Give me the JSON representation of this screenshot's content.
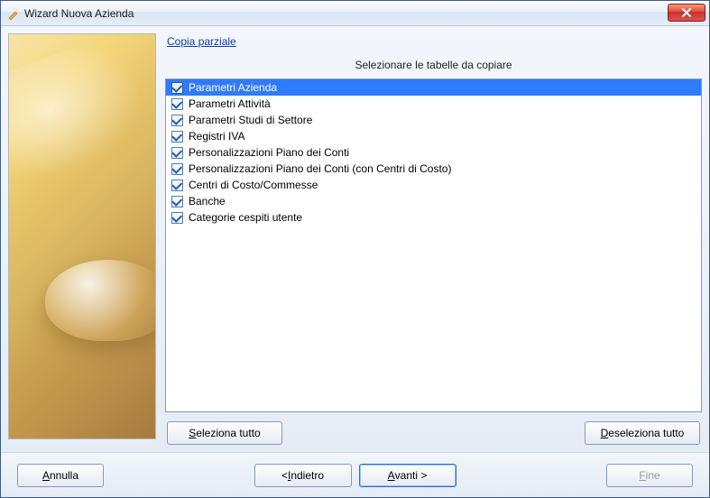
{
  "window": {
    "title": "Wizard Nuova Azienda"
  },
  "header": {
    "partial_copy_link": "Copia parziale",
    "instruction": "Selezionare le tabelle da copiare"
  },
  "tables": [
    {
      "label": "Parametri Azienda",
      "checked": true,
      "selected": true
    },
    {
      "label": "Parametri Attività",
      "checked": true,
      "selected": false
    },
    {
      "label": "Parametri Studi di Settore",
      "checked": true,
      "selected": false
    },
    {
      "label": "Registri IVA",
      "checked": true,
      "selected": false
    },
    {
      "label": "Personalizzazioni Piano dei Conti",
      "checked": true,
      "selected": false
    },
    {
      "label": "Personalizzazioni Piano dei Conti (con Centri di Costo)",
      "checked": true,
      "selected": false
    },
    {
      "label": "Centri di Costo/Commesse",
      "checked": true,
      "selected": false
    },
    {
      "label": "Banche",
      "checked": true,
      "selected": false
    },
    {
      "label": "Categorie cespiti utente",
      "checked": true,
      "selected": false
    }
  ],
  "buttons": {
    "select_all_pre": "",
    "select_all_u": "S",
    "select_all_post": "eleziona tutto",
    "deselect_all_pre": "",
    "deselect_all_u": "D",
    "deselect_all_post": "eseleziona tutto",
    "cancel_pre": "",
    "cancel_u": "A",
    "cancel_post": "nnulla",
    "back_pre": "< ",
    "back_u": "I",
    "back_post": "ndietro",
    "next_pre": "",
    "next_u": "A",
    "next_post": "vanti >",
    "finish_pre": "",
    "finish_u": "F",
    "finish_post": "ine"
  }
}
